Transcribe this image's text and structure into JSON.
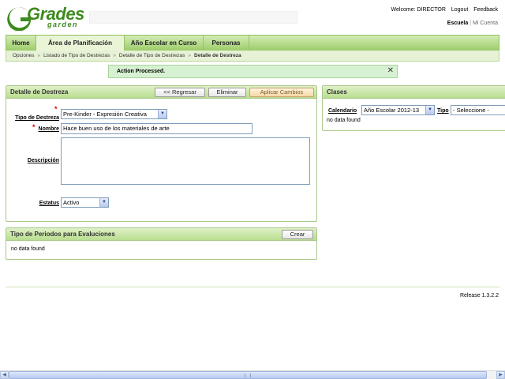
{
  "logo": {
    "word1": "Grades",
    "word2": "garden"
  },
  "header": {
    "welcome": "Welcome: DIRECTOR",
    "logout": "Logout",
    "feedback": "Feedback",
    "school": "Escuela",
    "separator": "|",
    "account": "Mi Cuenta"
  },
  "nav": {
    "tabs": [
      {
        "label": "Home"
      },
      {
        "label": "Área de Planificación"
      },
      {
        "label": "Año Escolar en Curso"
      },
      {
        "label": "Personas"
      }
    ],
    "active_tab": "Área de Planificación"
  },
  "breadcrumb": {
    "items": [
      "Opciones",
      "Listado de Tipo de Destrezas",
      "Detalle de Tipo de Destrezas",
      "Detalle de Destreza"
    ],
    "separator": "»"
  },
  "message": {
    "text": "Action Processed.",
    "close": "✕"
  },
  "detail": {
    "title": "Detalle de Destreza",
    "buttons": {
      "back": "<< Regresar",
      "delete": "Eliminar",
      "apply": "Aplicar Cambios"
    },
    "required_mark": "*",
    "fields": {
      "tipo_label": "Tipo de Destreza",
      "tipo_value": "Pre-Kinder - Expresión Creativa",
      "nombre_label": "Nombre",
      "nombre_value": "Hace buen uso de los materiales de arte",
      "descripcion_label": "Descripción",
      "descripcion_value": "",
      "estatus_label": "Estatus",
      "estatus_value": "Activo"
    }
  },
  "clases": {
    "title": "Clases",
    "calendario_label": "Calendario",
    "calendario_value": "Año Escolar 2012-13",
    "tipo_label": "Tipo",
    "tipo_value": "- Seleccione -",
    "empty": "no data found"
  },
  "periodos": {
    "title": "Tipo de Periodos para Evaluciones",
    "create": "Crear",
    "empty": "no data found"
  },
  "footer": {
    "release": "Release 1.3.2.2"
  },
  "icons": {
    "dropdown": "chevron-down-icon",
    "close": "close-icon",
    "scroll_left": "arrow-left-icon",
    "scroll_right": "arrow-right-icon"
  },
  "colors": {
    "brand_green": "#3d8a1e",
    "nav_green": "#9ccc6a",
    "message_bg": "#d7f2d2",
    "required": "#dd0000"
  }
}
